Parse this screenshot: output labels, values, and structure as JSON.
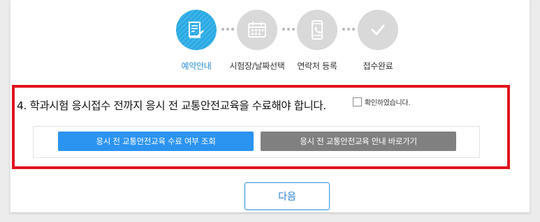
{
  "steps": [
    {
      "label": "예약안내",
      "icon": "document-pen-icon",
      "active": true
    },
    {
      "label": "시험장/날짜선택",
      "icon": "calendar-icon",
      "active": false
    },
    {
      "label": "연락처 등록",
      "icon": "phone-icon",
      "active": false
    },
    {
      "label": "접수완료",
      "icon": "checkmark-icon",
      "active": false
    }
  ],
  "notice": {
    "text": "4. 학과시험 응시접수 전까지 응시 전 교통안전교육을 수료해야 합니다.",
    "confirm_label": "확인하였습니다.",
    "confirm_checked": false
  },
  "buttons": {
    "check_completion": "응시 전 교통안전교육 수료 여부 조회",
    "go_guide": "응시 전 교통안전교육 안내 바로가기"
  },
  "next_label": "다음",
  "colors": {
    "accent": "#29a9e4",
    "highlight_border": "#e0141e",
    "primary_button": "#2b93f0",
    "secondary_button": "#808080",
    "inactive_step": "#d9d9d9"
  }
}
